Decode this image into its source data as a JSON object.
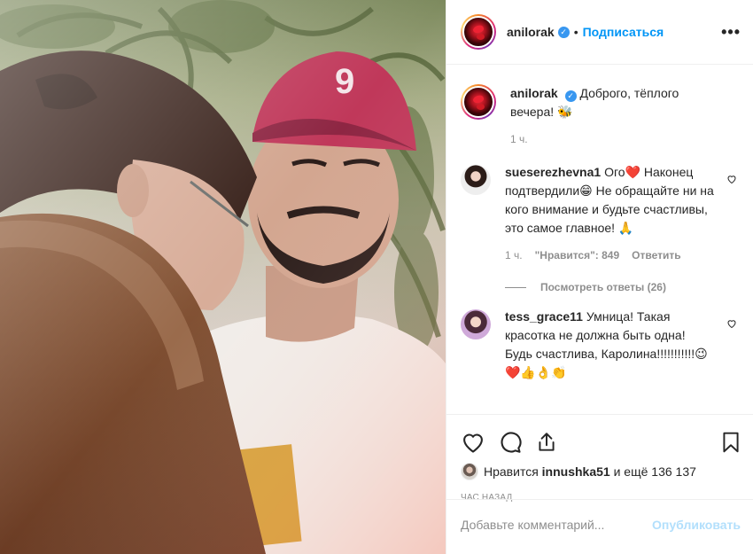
{
  "post": {
    "username": "anilorak",
    "follow_label": "Подписаться",
    "more_label": "•••",
    "dot": "•",
    "caption_text": "Доброго, тёплого вечера! 🐝",
    "caption_time": "1 ч."
  },
  "comments": [
    {
      "username": "sueserezhevna1",
      "text": "Ого❤️ Наконец подтвердили😁 Не обращайте ни на кого внимание и будьте счастливы, это самое главное! 🙏",
      "time": "1 ч.",
      "likes": "\"Нравится\": 849",
      "reply_label": "Ответить",
      "view_replies": "Посмотреть ответы (26)"
    },
    {
      "username": "tess_grace11",
      "text": "Умница! Такая красотка не должна быть одна! Будь счастлива, Каролина!!!!!!!!!!!😉❤️👍👌👏"
    }
  ],
  "likes_line": {
    "prefix": "Нравится",
    "user": "innushka51",
    "suffix": "и ещё 136 137"
  },
  "posted_ago": "ЧАС НАЗАД",
  "comment_box": {
    "placeholder": "Добавьте комментарий...",
    "publish_label": "Опубликовать"
  },
  "colors": {
    "accent": "#0095f6",
    "verified": "#3897f0",
    "publish_disabled": "#b2dffc",
    "cap": "#c0385a"
  },
  "photo": {
    "cap_logo": "9"
  }
}
